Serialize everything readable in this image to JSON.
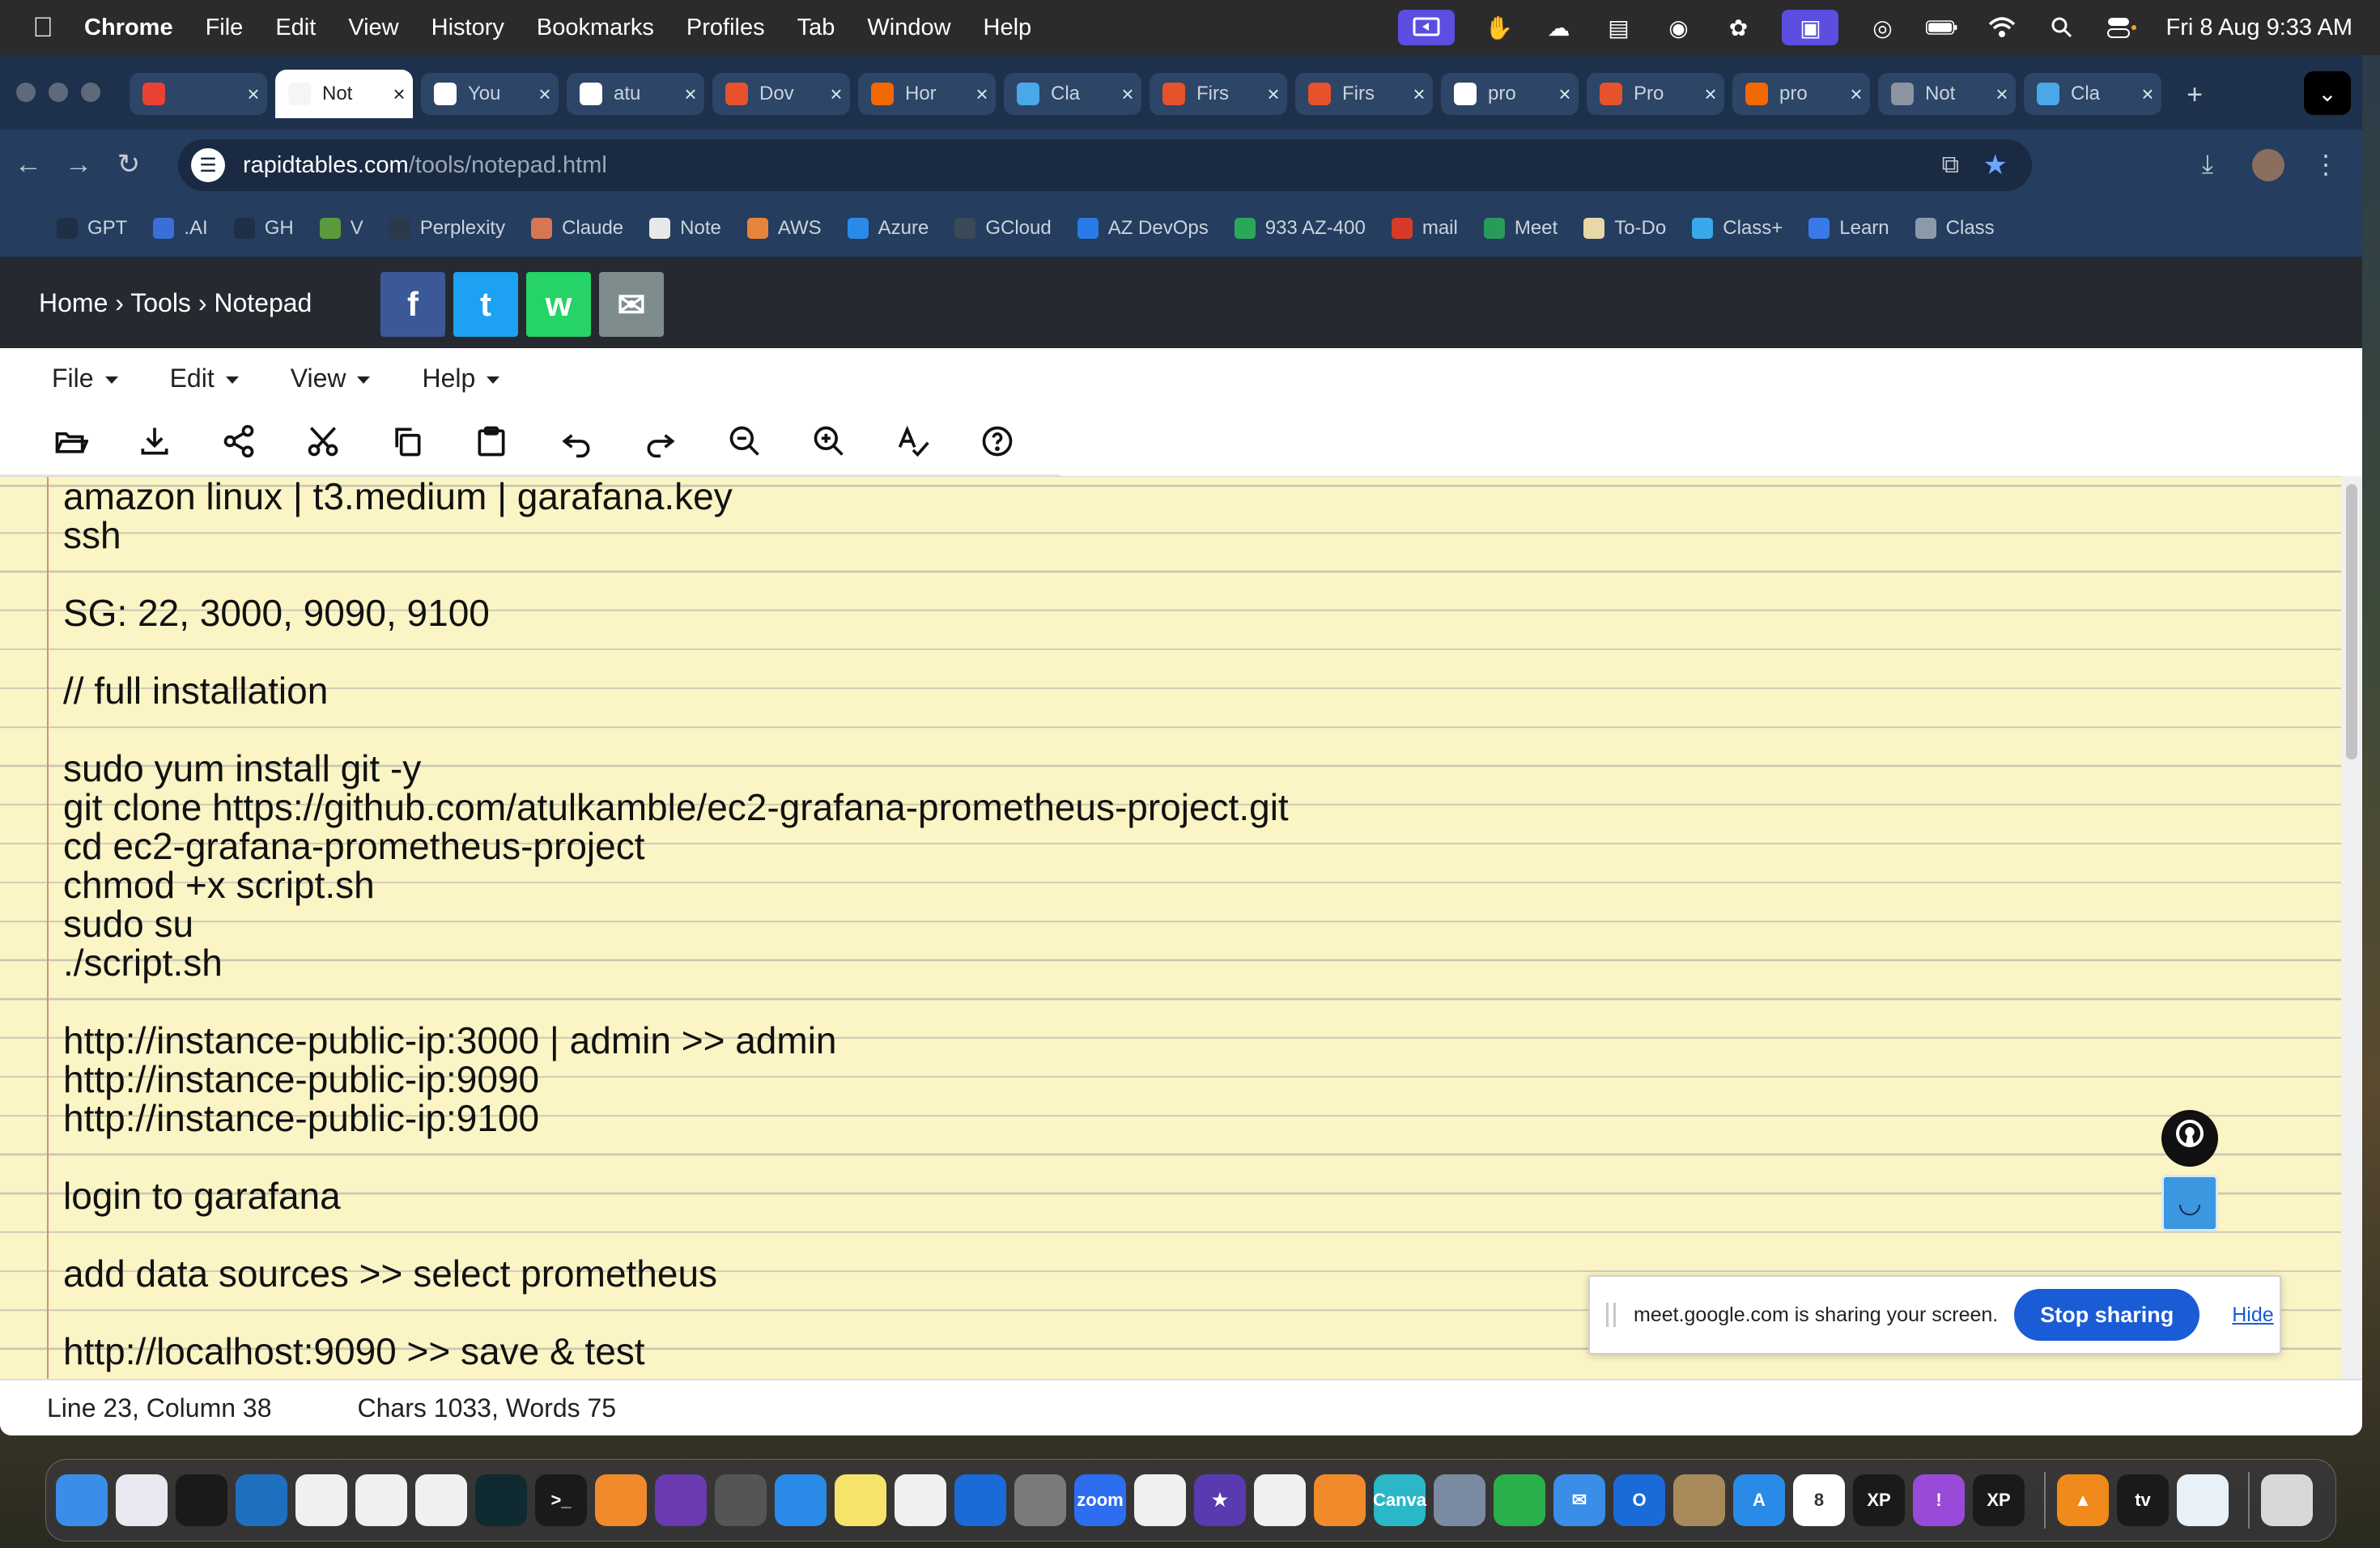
{
  "menubar": {
    "app": "Chrome",
    "items": [
      "File",
      "Edit",
      "View",
      "History",
      "Bookmarks",
      "Profiles",
      "Tab",
      "Window",
      "Help"
    ],
    "clock": "Fri 8 Aug  9:33 AM"
  },
  "tabs": [
    {
      "title": "",
      "icon": "color-wheel",
      "color": "#e94235"
    },
    {
      "title": "Not",
      "icon": "notepad",
      "color": "#f5f5f5",
      "active": true
    },
    {
      "title": "You",
      "icon": "github",
      "color": "#ffffff"
    },
    {
      "title": "atu",
      "icon": "github",
      "color": "#ffffff"
    },
    {
      "title": "Dov",
      "icon": "prometheus",
      "color": "#e6522c"
    },
    {
      "title": "Hor",
      "icon": "grafana",
      "color": "#f46800"
    },
    {
      "title": "Cla",
      "icon": "diamond",
      "color": "#4aa8e8"
    },
    {
      "title": "Firs",
      "icon": "fire",
      "color": "#e6522c"
    },
    {
      "title": "Firs",
      "icon": "fire",
      "color": "#e6522c"
    },
    {
      "title": "pro",
      "icon": "github",
      "color": "#ffffff"
    },
    {
      "title": "Pro",
      "icon": "prometheus",
      "color": "#e6522c"
    },
    {
      "title": "pro",
      "icon": "grafana",
      "color": "#f46800"
    },
    {
      "title": "Not",
      "icon": "globe",
      "color": "#8b94a0"
    },
    {
      "title": "Cla",
      "icon": "diamond",
      "color": "#4aa8e8"
    }
  ],
  "address": {
    "domain": "rapidtables.com",
    "path": "/tools/notepad.html"
  },
  "bookmarks": [
    {
      "label": "GPT",
      "color": "#1f2f45"
    },
    {
      "label": ".AI",
      "color": "#3a6fd8"
    },
    {
      "label": "GH",
      "color": "#1f2f45"
    },
    {
      "label": "V",
      "color": "#5a9a3a"
    },
    {
      "label": "Perplexity",
      "color": "#2a3a4a"
    },
    {
      "label": "Claude",
      "color": "#d77655"
    },
    {
      "label": "Note",
      "color": "#e8e8e8"
    },
    {
      "label": "AWS",
      "color": "#e8833a"
    },
    {
      "label": "Azure",
      "color": "#2a8ae8"
    },
    {
      "label": "GCloud",
      "color": "#3a4a5a"
    },
    {
      "label": "AZ DevOps",
      "color": "#2a7ae8"
    },
    {
      "label": "933 AZ-400",
      "color": "#2aa85a"
    },
    {
      "label": "mail",
      "color": "#d83a2a"
    },
    {
      "label": "Meet",
      "color": "#2a9a5a"
    },
    {
      "label": "To-Do",
      "color": "#e8d8a8"
    },
    {
      "label": "Class+",
      "color": "#3aa8e8"
    },
    {
      "label": "Learn",
      "color": "#3a7ae8"
    },
    {
      "label": "Class",
      "color": "#8a9aaa"
    }
  ],
  "site": {
    "breadcrumb": "Home › Tools › Notepad",
    "share": [
      {
        "name": "facebook",
        "glyph": "f",
        "color": "#3b5998"
      },
      {
        "name": "twitter",
        "glyph": "t",
        "color": "#1da1f2"
      },
      {
        "name": "whatsapp",
        "glyph": "w",
        "color": "#25d366"
      },
      {
        "name": "email",
        "glyph": "✉",
        "color": "#7f8c8d"
      }
    ]
  },
  "notepad": {
    "menus": [
      "File",
      "Edit",
      "View",
      "Help"
    ],
    "text": "amazon linux | t3.medium | garafana.key\nssh\n\nSG: 22, 3000, 9090, 9100\n\n// full installation\n\nsudo yum install git -y\ngit clone https://github.com/atulkamble/ec2-grafana-prometheus-project.git\ncd ec2-grafana-prometheus-project\nchmod +x script.sh\nsudo su\n./script.sh\n\nhttp://instance-public-ip:3000 | admin >> admin\nhttp://instance-public-ip:9090\nhttp://instance-public-ip:9100\n\nlogin to garafana\n\nadd data sources >> select prometheus\n\nhttp://localhost:9090 >> save & test",
    "status": {
      "position": "Line 23, Column 38",
      "counts": "Chars 1033, Words 75"
    }
  },
  "share_banner": {
    "message": "meet.google.com is sharing your screen.",
    "stop_label": "Stop sharing",
    "hide_label": "Hide"
  },
  "dock": [
    {
      "name": "finder",
      "color": "#3a8ee8",
      "glyph": ""
    },
    {
      "name": "launchpad",
      "color": "#e8e8f0",
      "glyph": ""
    },
    {
      "name": "chatgpt-app",
      "color": "#1a1a1a",
      "glyph": ""
    },
    {
      "name": "vscode",
      "color": "#1f6fc0",
      "glyph": ""
    },
    {
      "name": "openai",
      "color": "#f0f0f0",
      "glyph": ""
    },
    {
      "name": "chrome",
      "color": "#f0f0f0",
      "glyph": ""
    },
    {
      "name": "keyshape",
      "color": "#f0f0f0",
      "glyph": ""
    },
    {
      "name": "perplexity",
      "color": "#0f2a30",
      "glyph": ""
    },
    {
      "name": "terminal",
      "color": "#1a1a1a",
      "glyph": ">_"
    },
    {
      "name": "sublime-merge",
      "color": "#f08a2a",
      "glyph": ""
    },
    {
      "name": "github-desktop",
      "color": "#6a3ab0",
      "glyph": ""
    },
    {
      "name": "screenshot",
      "color": "#555",
      "glyph": ""
    },
    {
      "name": "safari",
      "color": "#2a8ae8",
      "glyph": ""
    },
    {
      "name": "notes",
      "color": "#f5e36a",
      "glyph": ""
    },
    {
      "name": "freeform",
      "color": "#f0f0f0",
      "glyph": ""
    },
    {
      "name": "onedrive",
      "color": "#1a6ad8",
      "glyph": ""
    },
    {
      "name": "system-settings",
      "color": "#7a7a7a",
      "glyph": ""
    },
    {
      "name": "zoom",
      "color": "#2d6ef0",
      "glyph": "zoom"
    },
    {
      "name": "google-drive",
      "color": "#f0f0f0",
      "glyph": ""
    },
    {
      "name": "imovie",
      "color": "#5a3ab0",
      "glyph": "★"
    },
    {
      "name": "reminders",
      "color": "#f0f0f0",
      "glyph": ""
    },
    {
      "name": "pages",
      "color": "#f08a2a",
      "glyph": ""
    },
    {
      "name": "canva",
      "color": "#2ab8c8",
      "glyph": "Canva"
    },
    {
      "name": "preview",
      "color": "#7a8aa0",
      "glyph": ""
    },
    {
      "name": "numbers",
      "color": "#2ab04a",
      "glyph": ""
    },
    {
      "name": "mail",
      "color": "#3a8ee8",
      "glyph": "✉"
    },
    {
      "name": "outlook",
      "color": "#1a6ad8",
      "glyph": "O"
    },
    {
      "name": "contacts",
      "color": "#a88a5a",
      "glyph": ""
    },
    {
      "name": "app-store",
      "color": "#2a8ae8",
      "glyph": "A"
    },
    {
      "name": "calendar",
      "color": "#ffffff",
      "glyph": "8"
    },
    {
      "name": "xp-pen-1",
      "color": "#1a1a1a",
      "glyph": "XP"
    },
    {
      "name": "feedback",
      "color": "#9a4ad8",
      "glyph": "!"
    },
    {
      "name": "xp-pen-2",
      "color": "#1a1a1a",
      "glyph": "XP"
    },
    {
      "name": "vlc",
      "color": "#f08a1a",
      "glyph": "▲"
    },
    {
      "name": "apple-tv",
      "color": "#1a1a1a",
      "glyph": "tv"
    },
    {
      "name": "drive-app",
      "color": "#e8f0f8",
      "glyph": ""
    },
    {
      "name": "trash",
      "color": "#d8d8d8",
      "glyph": ""
    }
  ]
}
